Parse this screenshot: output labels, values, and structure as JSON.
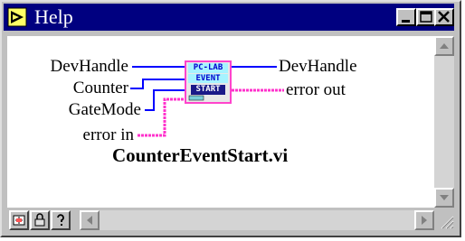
{
  "window": {
    "title": "Help"
  },
  "title_buttons": {
    "minimize": "minimize",
    "maximize": "maximize",
    "close": "close"
  },
  "vi_icon": {
    "line1": "PC-LAB",
    "line2": "EVENT",
    "line3": "START"
  },
  "terminals": {
    "inputs": [
      "DevHandle",
      "Counter",
      "GateMode",
      "error in"
    ],
    "outputs": [
      "DevHandle",
      "error out"
    ]
  },
  "vi_name": "CounterEventStart.vi",
  "toolbar": {
    "icons": [
      "show-terminals-icon",
      "lock-icon",
      "help-question-icon"
    ]
  },
  "colors": {
    "titlebar": "#000080",
    "wire_blue": "#0000ff",
    "wire_error": "#ff33cc",
    "icon_frame": "#ff44cc"
  }
}
